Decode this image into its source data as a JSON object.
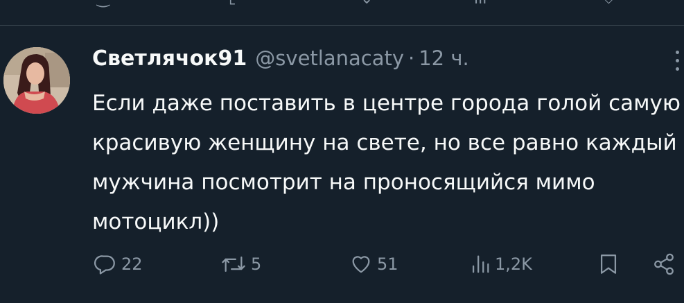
{
  "tweet": {
    "display_name": "Светлячок91",
    "handle": "@svetlanacaty",
    "separator": "·",
    "time": "12 ч.",
    "text": "Если даже поставить в центре города голой самую красивую женщину на свете, но все равно каждый мужчина посмотрит на проносящийся мимо мотоцикл))",
    "actions": {
      "replies": "22",
      "reposts": "5",
      "likes": "51",
      "views": "1,2K"
    }
  },
  "icons": [
    "reply-icon",
    "repost-icon",
    "like-icon",
    "views-icon",
    "bookmark-icon",
    "share-icon",
    "more-icon"
  ],
  "colors": {
    "background": "#15202b",
    "text": "#f7f9f9",
    "secondary": "#8b98a5",
    "divider": "#38444d"
  }
}
